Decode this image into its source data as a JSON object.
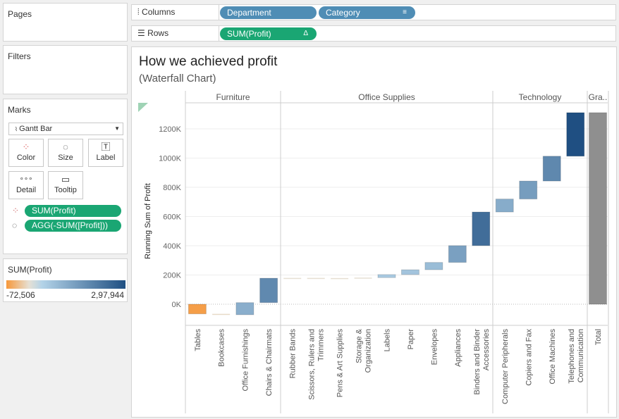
{
  "panels": {
    "pages": "Pages",
    "filters": "Filters",
    "marks": "Marks"
  },
  "shelves": {
    "columns_label": "Columns",
    "rows_label": "Rows",
    "columns": [
      "Department",
      "Category"
    ],
    "rows": [
      "SUM(Profit)"
    ]
  },
  "marks": {
    "type": "Gantt Bar",
    "buttons": [
      "Color",
      "Size",
      "Label",
      "Detail",
      "Tooltip"
    ],
    "fields": [
      "SUM(Profit)",
      "AGG(-SUM([Profit]))"
    ]
  },
  "legend": {
    "title": "SUM(Profit)",
    "min": "-72,506",
    "max": "2,97,944",
    "colors": {
      "negative": "#f7983a",
      "zero": "#e6e0d4",
      "low": "#b3d3e8",
      "high": "#1f4f82"
    }
  },
  "chart": {
    "title": "How we achieved profit",
    "subtitle": "(Waterfall Chart)"
  },
  "chart_data": {
    "type": "bar",
    "subtype": "waterfall",
    "ylabel": "Running Sum of Profit",
    "yticks": [
      "0K",
      "200K",
      "400K",
      "600K",
      "800K",
      "1000K",
      "1200K"
    ],
    "ylim": [
      -140000,
      1360000
    ],
    "grid": true,
    "groups": [
      {
        "name": "Furniture",
        "categories": [
          [
            "Tables"
          ],
          [
            "Bookcases"
          ],
          [
            "Office Furnishings"
          ],
          [
            "Chairs & Chairmats"
          ]
        ],
        "values": [
          -66000,
          -6000,
          83000,
          167000
        ]
      },
      {
        "name": "Office Supplies",
        "categories": [
          [
            "Rubber Bands"
          ],
          [
            "Scissors, Rulers and",
            "Trimmers"
          ],
          [
            "Pens & Art Supplies"
          ],
          [
            "Storage &",
            "Organization"
          ],
          [
            "Labels"
          ],
          [
            "Paper"
          ],
          [
            "Envelopes"
          ],
          [
            "Appliances"
          ],
          [
            "Binders and Binder",
            "Accessories"
          ]
        ],
        "values": [
          2000,
          -1000,
          -1000,
          4000,
          21000,
          33000,
          50000,
          115000,
          230000
        ]
      },
      {
        "name": "Technology",
        "categories": [
          [
            "Computer Peripherals"
          ],
          [
            "Copiers and Fax"
          ],
          [
            "Office Machines"
          ],
          [
            "Telephones and",
            "Communication"
          ]
        ],
        "values": [
          89000,
          123000,
          170000,
          298000
        ]
      },
      {
        "name": "Gra..",
        "categories": [
          [
            "Total"
          ]
        ],
        "values": [
          1311000
        ],
        "total": true
      }
    ]
  }
}
